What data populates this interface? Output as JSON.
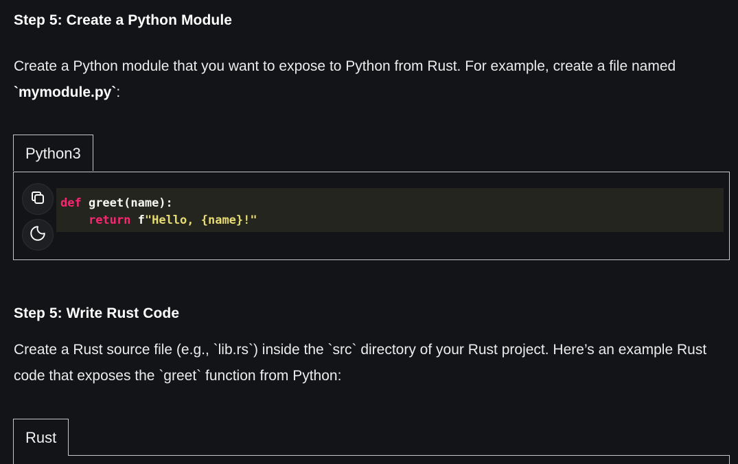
{
  "section1": {
    "heading": "Step 5: Create a Python Module",
    "para_prefix": "Create a Python module that you want to expose to Python from Rust. For example, create a file named ",
    "para_code": "`mymodule.py`",
    "para_suffix": ":"
  },
  "code_block_1": {
    "tab_label": "Python3",
    "copy_icon": "copy-icon",
    "theme_icon": "moon-icon",
    "line1_kw": "def",
    "line1_rest": " greet(name):",
    "line2_indent": "    ",
    "line2_kw": "return",
    "line2_mid": " f",
    "line2_str": "\"Hello, {name}!\""
  },
  "section2": {
    "heading": "Step 5: Write Rust Code",
    "para": "Create a Rust source file (e.g., `lib.rs`) inside the `src` directory of your Rust project. Here’s an example Rust code that exposes the `greet` function from Python:"
  },
  "code_block_2": {
    "tab_label": "Rust"
  },
  "colors": {
    "background": "#131417",
    "keyword": "#f92672",
    "string": "#e6db74",
    "code_bg": "#24251f"
  }
}
